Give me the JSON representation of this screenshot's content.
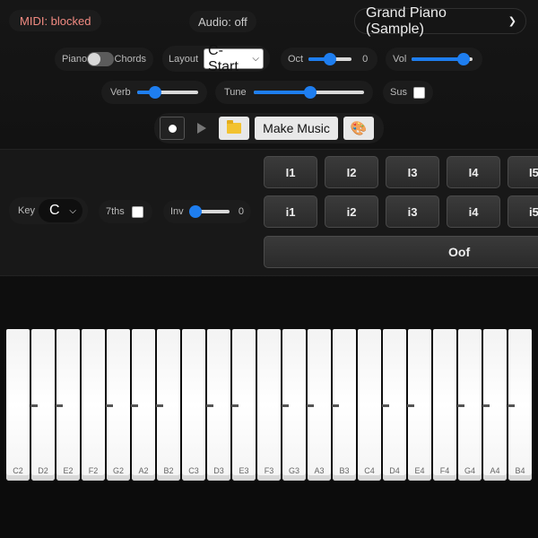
{
  "status": {
    "midi": "MIDI: blocked",
    "audio": "Audio: off"
  },
  "instrument": {
    "selected": "Grand Piano (Sample)"
  },
  "controls": {
    "mode_left": "Piano",
    "mode_right": "Chords",
    "layout_label": "Layout",
    "layout_value": "C-Start",
    "oct_label": "Oct",
    "oct_value": "0",
    "oct_level": 0.5,
    "vol_label": "Vol",
    "vol_level": 0.85,
    "verb_label": "Verb",
    "verb_level": 0.3,
    "tune_label": "Tune",
    "tune_level": 0.5,
    "sus_label": "Sus"
  },
  "transport": {
    "make_music": "Make Music",
    "palette_glyph": "🎨"
  },
  "chords": {
    "key_label": "Key",
    "key_value": "C",
    "sevenths_label": "7ths",
    "inv_label": "Inv",
    "inv_value": "0",
    "inv_level": 0.0,
    "upper": [
      "I1",
      "I2",
      "I3",
      "I4",
      "I5"
    ],
    "lower": [
      "i1",
      "i2",
      "i3",
      "i4",
      "i5"
    ],
    "oof": "Oof"
  },
  "piano": {
    "keys": [
      "C2",
      "D2",
      "E2",
      "F2",
      "G2",
      "A2",
      "B2",
      "C3",
      "D3",
      "E3",
      "F3",
      "G3",
      "A3",
      "B3",
      "C4",
      "D4",
      "E4",
      "F4",
      "G4",
      "A4",
      "B4"
    ]
  },
  "colors": {
    "accent": "#1e7ef0",
    "midi_warning": "#f28b82"
  }
}
